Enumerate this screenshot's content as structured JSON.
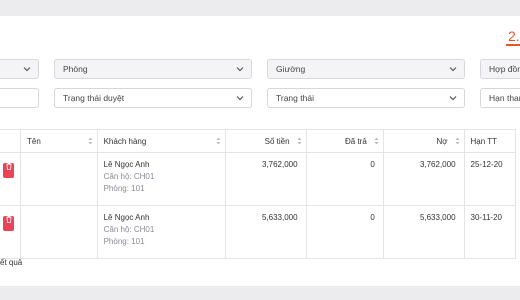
{
  "total_label": "2.",
  "filters": {
    "row1": [
      {
        "value": ""
      },
      {
        "value": "Phòng"
      },
      {
        "value": "Giường"
      },
      {
        "value": "Hợp đồng"
      }
    ],
    "row2": [
      {
        "value": ""
      },
      {
        "value": "Trạng thái duyệt"
      },
      {
        "value": "Trạng thái"
      },
      {
        "value": "Hạn thanh"
      }
    ]
  },
  "table": {
    "headers": {
      "name": "Tên",
      "customer": "Khách hàng",
      "amount": "Số tiền",
      "paid": "Đã trả",
      "debt": "Nợ",
      "due": "Hạn TT"
    },
    "rows": [
      {
        "customer": "Lê Ngọc Anh",
        "apartment": "Căn hộ: CH01",
        "room": "Phòng: 101",
        "amount": "3,762,000",
        "paid": "0",
        "debt": "3,762,000",
        "due": "25-12-20"
      },
      {
        "customer": "Lê Ngọc Anh",
        "apartment": "Căn hộ: CH01",
        "room": "Phòng: 101",
        "amount": "5,633,000",
        "paid": "0",
        "debt": "5,633,000",
        "due": "30-11-20"
      }
    ]
  },
  "footer_text": "ết quả",
  "colors": {
    "accent": "#e8542a",
    "delete": "#e94356"
  },
  "icons": {
    "chevron": "chevron-down-icon",
    "sort": "sort-icon",
    "delete": "trash-icon"
  }
}
